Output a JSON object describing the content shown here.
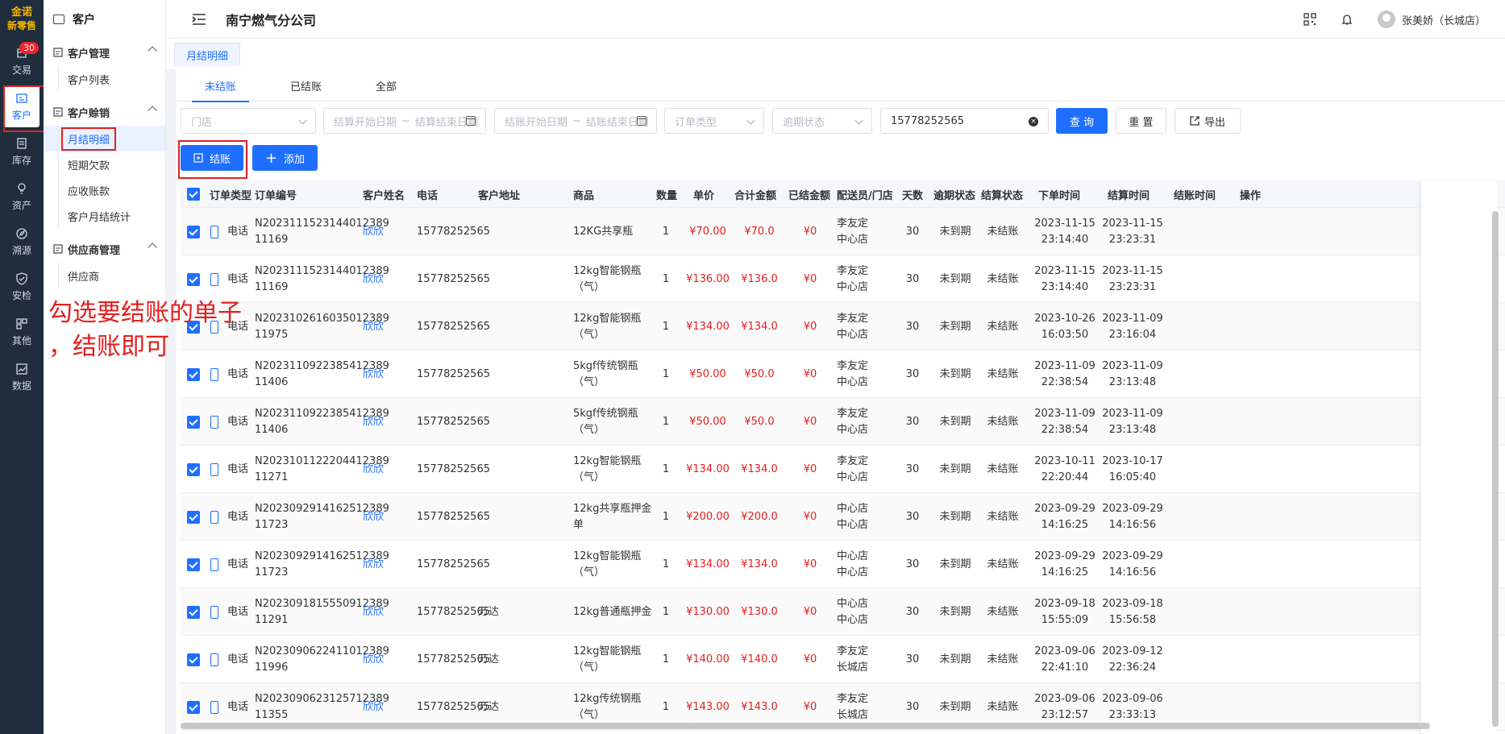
{
  "brand": {
    "line1": "金诺",
    "line2": "新零售"
  },
  "rail": [
    {
      "label": "交易",
      "icon": "trade-icon",
      "badge": "30"
    },
    {
      "label": "客户",
      "icon": "customer-icon",
      "active": true
    },
    {
      "label": "库存",
      "icon": "inventory-icon"
    },
    {
      "label": "资产",
      "icon": "asset-icon"
    },
    {
      "label": "溯源",
      "icon": "trace-icon"
    },
    {
      "label": "安检",
      "icon": "safety-icon"
    },
    {
      "label": "其他",
      "icon": "other-icon"
    },
    {
      "label": "数据",
      "icon": "data-icon"
    }
  ],
  "submenu": {
    "title": "客户",
    "groups": [
      {
        "label": "客户管理",
        "items": [
          "客户列表"
        ]
      },
      {
        "label": "客户赊销",
        "items": [
          "月结明细",
          "短期欠款",
          "应收账款",
          "客户月结统计"
        ]
      },
      {
        "label": "供应商管理",
        "items": [
          "供应商"
        ]
      }
    ]
  },
  "header": {
    "title": "南宁燃气分公司",
    "user": "张美娇（长城店）"
  },
  "tag": "月结明细",
  "tabs": [
    "未结账",
    "已结账",
    "全部"
  ],
  "filters": {
    "store": "门店",
    "settle_start": "结算开始日期",
    "settle_end": "结算结束日期",
    "close_start": "结账开始日期",
    "close_end": "结账结束日期",
    "range_sep": "~",
    "order_type": "订单类型",
    "overdue": "逾期状态",
    "search_value": "15778252565",
    "query": "查 询",
    "reset": "重 置",
    "export": "导出"
  },
  "actions": {
    "settle": "结账",
    "add": "添加"
  },
  "columns": [
    "订单类型",
    "订单编号",
    "客户姓名",
    "电话",
    "客户地址",
    "商品",
    "数量",
    "单价",
    "合计金额",
    "已结金额",
    "配送员/门店",
    "天数",
    "逾期状态",
    "结算状态",
    "下单时间",
    "结算时间",
    "结账时间",
    "操作"
  ],
  "rows": [
    {
      "type": "电话",
      "no1": "N2023111523144012389",
      "no2": "11169",
      "name": "欣欣",
      "phone": "15778252565",
      "addr": "",
      "goods1": "12KG共享瓶",
      "goods2": "",
      "qty": "1",
      "price": "¥70.00",
      "total": "¥70.0",
      "paid": "¥0",
      "staff1": "李友定",
      "staff2": "中心店",
      "days": "30",
      "overdue": "未到期",
      "settle": "未结账",
      "od1": "2023-11-15",
      "od2": "23:14:40",
      "sd1": "2023-11-15",
      "sd2": "23:23:31"
    },
    {
      "type": "电话",
      "no1": "N2023111523144012389",
      "no2": "11169",
      "name": "欣欣",
      "phone": "15778252565",
      "addr": "",
      "goods1": "12kg智能钢瓶",
      "goods2": "（气）",
      "qty": "1",
      "price": "¥136.00",
      "total": "¥136.0",
      "paid": "¥0",
      "staff1": "李友定",
      "staff2": "中心店",
      "days": "30",
      "overdue": "未到期",
      "settle": "未结账",
      "od1": "2023-11-15",
      "od2": "23:14:40",
      "sd1": "2023-11-15",
      "sd2": "23:23:31"
    },
    {
      "type": "电话",
      "no1": "N2023102616035012389",
      "no2": "11975",
      "name": "欣欣",
      "phone": "15778252565",
      "addr": "",
      "goods1": "12kg智能钢瓶",
      "goods2": "（气）",
      "qty": "1",
      "price": "¥134.00",
      "total": "¥134.0",
      "paid": "¥0",
      "staff1": "李友定",
      "staff2": "中心店",
      "days": "30",
      "overdue": "未到期",
      "settle": "未结账",
      "od1": "2023-10-26",
      "od2": "16:03:50",
      "sd1": "2023-11-09",
      "sd2": "23:16:04"
    },
    {
      "type": "电话",
      "no1": "N2023110922385412389",
      "no2": "11406",
      "name": "欣欣",
      "phone": "15778252565",
      "addr": "",
      "goods1": "5kgf传统钢瓶",
      "goods2": "（气）",
      "qty": "1",
      "price": "¥50.00",
      "total": "¥50.0",
      "paid": "¥0",
      "staff1": "李友定",
      "staff2": "中心店",
      "days": "30",
      "overdue": "未到期",
      "settle": "未结账",
      "od1": "2023-11-09",
      "od2": "22:38:54",
      "sd1": "2023-11-09",
      "sd2": "23:13:48"
    },
    {
      "type": "电话",
      "no1": "N2023110922385412389",
      "no2": "11406",
      "name": "欣欣",
      "phone": "15778252565",
      "addr": "",
      "goods1": "5kgf传统钢瓶",
      "goods2": "（气）",
      "qty": "1",
      "price": "¥50.00",
      "total": "¥50.0",
      "paid": "¥0",
      "staff1": "李友定",
      "staff2": "中心店",
      "days": "30",
      "overdue": "未到期",
      "settle": "未结账",
      "od1": "2023-11-09",
      "od2": "22:38:54",
      "sd1": "2023-11-09",
      "sd2": "23:13:48"
    },
    {
      "type": "电话",
      "no1": "N2023101122204412389",
      "no2": "11271",
      "name": "欣欣",
      "phone": "15778252565",
      "addr": "",
      "goods1": "12kg智能钢瓶",
      "goods2": "（气）",
      "qty": "1",
      "price": "¥134.00",
      "total": "¥134.0",
      "paid": "¥0",
      "staff1": "李友定",
      "staff2": "中心店",
      "days": "30",
      "overdue": "未到期",
      "settle": "未结账",
      "od1": "2023-10-11",
      "od2": "22:20:44",
      "sd1": "2023-10-17",
      "sd2": "16:05:40"
    },
    {
      "type": "电话",
      "no1": "N2023092914162512389",
      "no2": "11723",
      "name": "欣欣",
      "phone": "15778252565",
      "addr": "",
      "goods1": "12kg共享瓶押金",
      "goods2": "单",
      "qty": "1",
      "price": "¥200.00",
      "total": "¥200.0",
      "paid": "¥0",
      "staff1": "中心店",
      "staff2": "中心店",
      "days": "30",
      "overdue": "未到期",
      "settle": "未结账",
      "od1": "2023-09-29",
      "od2": "14:16:25",
      "sd1": "2023-09-29",
      "sd2": "14:16:56"
    },
    {
      "type": "电话",
      "no1": "N2023092914162512389",
      "no2": "11723",
      "name": "欣欣",
      "phone": "15778252565",
      "addr": "",
      "goods1": "12kg智能钢瓶",
      "goods2": "（气）",
      "qty": "1",
      "price": "¥134.00",
      "total": "¥134.0",
      "paid": "¥0",
      "staff1": "中心店",
      "staff2": "中心店",
      "days": "30",
      "overdue": "未到期",
      "settle": "未结账",
      "od1": "2023-09-29",
      "od2": "14:16:25",
      "sd1": "2023-09-29",
      "sd2": "14:16:56"
    },
    {
      "type": "电话",
      "no1": "N2023091815550912389",
      "no2": "11291",
      "name": "欣欣",
      "phone": "15778252565",
      "addr": "万达",
      "goods1": "12kg普通瓶押金",
      "goods2": "",
      "qty": "1",
      "price": "¥130.00",
      "total": "¥130.0",
      "paid": "¥0",
      "staff1": "中心店",
      "staff2": "中心店",
      "days": "30",
      "overdue": "未到期",
      "settle": "未结账",
      "od1": "2023-09-18",
      "od2": "15:55:09",
      "sd1": "2023-09-18",
      "sd2": "15:56:58"
    },
    {
      "type": "电话",
      "no1": "N2023090622411012389",
      "no2": "11996",
      "name": "欣欣",
      "phone": "15778252565",
      "addr": "万达",
      "goods1": "12kg智能钢瓶",
      "goods2": "（气）",
      "qty": "1",
      "price": "¥140.00",
      "total": "¥140.0",
      "paid": "¥0",
      "staff1": "李友定",
      "staff2": "长城店",
      "days": "30",
      "overdue": "未到期",
      "settle": "未结账",
      "od1": "2023-09-06",
      "od2": "22:41:10",
      "sd1": "2023-09-12",
      "sd2": "22:36:24"
    },
    {
      "type": "电话",
      "no1": "N2023090623125712389",
      "no2": "11355",
      "name": "欣欣",
      "phone": "15778252565",
      "addr": "万达",
      "goods1": "12kg传统钢瓶",
      "goods2": "（气）",
      "qty": "1",
      "price": "¥143.00",
      "total": "¥143.0",
      "paid": "¥0",
      "staff1": "李友定",
      "staff2": "长城店",
      "days": "30",
      "overdue": "未到期",
      "settle": "未结账",
      "od1": "2023-09-06",
      "od2": "23:12:57",
      "sd1": "2023-09-06",
      "sd2": "23:33:13"
    }
  ],
  "annotation": {
    "line1": "勾选要结账的单子",
    "line2": "，结账即可"
  }
}
